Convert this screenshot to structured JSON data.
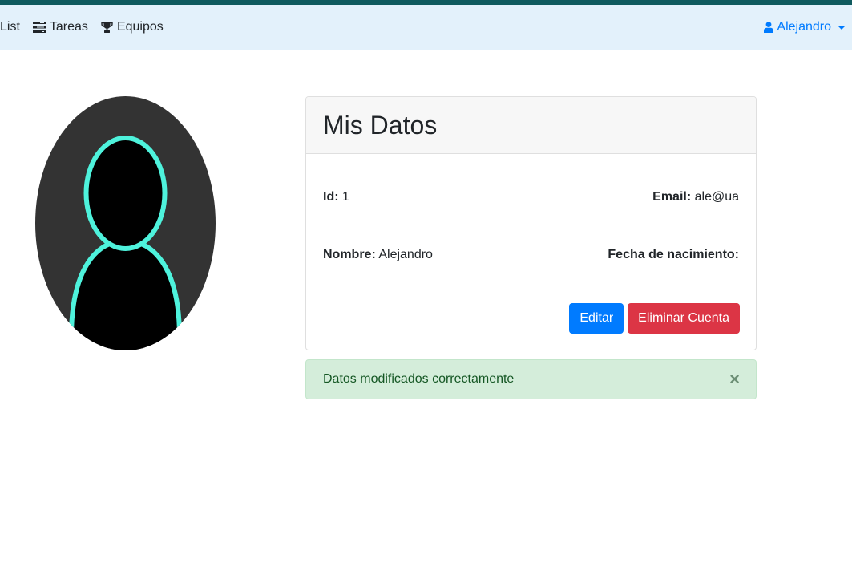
{
  "navbar": {
    "items": [
      {
        "label": "List",
        "icon": null
      },
      {
        "label": "Tareas",
        "icon": "tasks-icon"
      },
      {
        "label": "Equipos",
        "icon": "trophy-icon"
      }
    ],
    "user": {
      "label": "Alejandro",
      "icon": "user-icon"
    }
  },
  "card": {
    "title": "Mis Datos",
    "id_label": "Id:",
    "id_value": "1",
    "email_label": "Email:",
    "email_value": "ale@ua",
    "nombre_label": "Nombre:",
    "nombre_value": "Alejandro",
    "fecha_label": "Fecha de nacimiento:",
    "fecha_value": "",
    "edit_label": "Editar",
    "delete_label": "Eliminar Cuenta"
  },
  "alert": {
    "message": "Datos modificados correctamente",
    "close_symbol": "×"
  },
  "colors": {
    "primary": "#007bff",
    "danger": "#dc3545",
    "success_bg": "#d4edda",
    "navbar_bg": "#e3f1fb",
    "top_strip": "#0f5a5e",
    "avatar_outline": "#4ef2dc"
  }
}
